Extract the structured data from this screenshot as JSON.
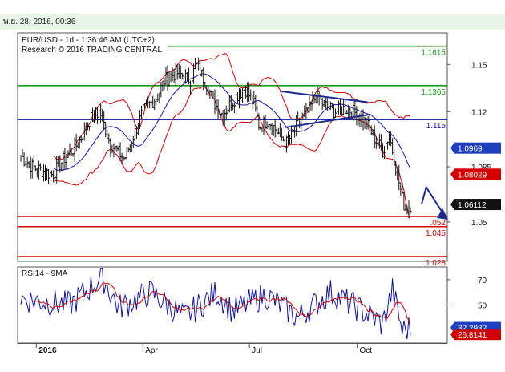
{
  "header": {
    "date": "พ.ย. 28, 2016, 00:36"
  },
  "chart_data": [
    {
      "type": "candlestick",
      "title": "EUR/USD - 1d - 1:36:46 AM (UTC+2)",
      "subtitle": "Research © 2016 TRADING CENTRAL",
      "ylim": [
        1.025,
        1.17
      ],
      "y_ticks": [
        1.15,
        1.12,
        1.085,
        1.05
      ],
      "x_ticks": [
        "2016",
        "Apr",
        "Jul",
        "Oct"
      ],
      "levels": [
        {
          "label": "1.1615",
          "value": 1.1615,
          "color": "#1f9a1f"
        },
        {
          "label": "1.1365",
          "value": 1.1365,
          "color": "#1f9a1f"
        },
        {
          "label": "1.115",
          "value": 1.115,
          "color": "#1111aa"
        },
        {
          "label": ".052",
          "value": 1.0535,
          "color": "#d40000"
        },
        {
          "label": "1.045",
          "value": 1.047,
          "color": "#d40000"
        },
        {
          "label": "1.028",
          "value": 1.028,
          "color": "#d40000"
        }
      ],
      "price_tags": [
        {
          "label": "1.0969",
          "value": 1.0969,
          "bg": "#1f3fbf",
          "fg": "#ffffff"
        },
        {
          "label": "1.08029",
          "value": 1.0803,
          "bg": "#d40000",
          "fg": "#ffffff"
        },
        {
          "label": "1.06112",
          "value": 1.0611,
          "bg": "#111111",
          "fg": "#ffffff"
        }
      ],
      "series": [
        {
          "name": "price",
          "color": "#111111"
        },
        {
          "name": "bollinger",
          "color": "#d40000"
        },
        {
          "name": "moving-average",
          "color": "#1111aa"
        }
      ],
      "trend_lines": [
        {
          "from": [
            "2016-07-27",
            1.133
          ],
          "to": [
            "2016-10-10",
            1.126
          ]
        },
        {
          "from": [
            "2016-08-01",
            1.11
          ],
          "to": [
            "2016-10-10",
            1.118
          ]
        }
      ],
      "projection": [
        [
          "2016-11-25",
          1.0611
        ],
        [
          "2016-11-29",
          1.072
        ],
        [
          "2016-12-15",
          1.0535
        ]
      ]
    },
    {
      "type": "line",
      "title": "RSI14 - 9MA",
      "ylim": [
        20,
        80
      ],
      "y_ticks": [
        70,
        50
      ],
      "series": [
        {
          "name": "RSI14",
          "color": "#1111aa"
        },
        {
          "name": "9MA",
          "color": "#d40000"
        }
      ],
      "price_tags": [
        {
          "label": "32.2932",
          "value": 32.29,
          "bg": "#1f3fbf",
          "fg": "#ffffff"
        },
        {
          "label": "26.8141",
          "value": 26.81,
          "bg": "#d40000",
          "fg": "#ffffff"
        }
      ]
    }
  ]
}
